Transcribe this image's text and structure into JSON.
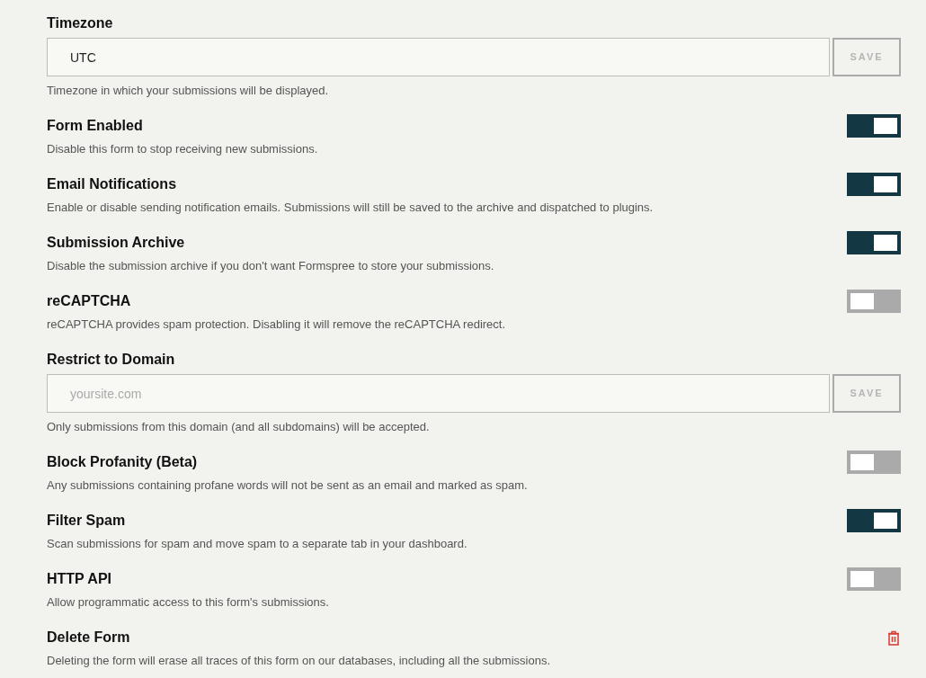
{
  "settings": [
    {
      "kind": "text",
      "title": "Timezone",
      "value": "UTC",
      "button": "SAVE",
      "description": "Timezone in which your submissions will be displayed."
    },
    {
      "kind": "toggle",
      "title": "Form Enabled",
      "on": true,
      "description": "Disable this form to stop receiving new submissions."
    },
    {
      "kind": "toggle",
      "title": "Email Notifications",
      "on": true,
      "description": "Enable or disable sending notification emails. Submissions will still be saved to the archive and dispatched to plugins."
    },
    {
      "kind": "toggle",
      "title": "Submission Archive",
      "on": true,
      "description": "Disable the submission archive if you don't want Formspree to store your submissions."
    },
    {
      "kind": "toggle",
      "title": "reCAPTCHA",
      "on": false,
      "description": "reCAPTCHA provides spam protection. Disabling it will remove the reCAPTCHA redirect."
    },
    {
      "kind": "text",
      "title": "Restrict to Domain",
      "placeholder": "yoursite.com",
      "button": "SAVE",
      "description": "Only submissions from this domain (and all subdomains) will be accepted."
    },
    {
      "kind": "toggle",
      "title": "Block Profanity (Beta)",
      "on": false,
      "description": "Any submissions containing profane words will not be sent as an email and marked as spam."
    },
    {
      "kind": "toggle",
      "title": "Filter Spam",
      "on": true,
      "description": "Scan submissions for spam and move spam to a separate tab in your dashboard."
    },
    {
      "kind": "toggle",
      "title": "HTTP API",
      "on": false,
      "description": "Allow programmatic access to this form's submissions."
    },
    {
      "kind": "delete",
      "title": "Delete Form",
      "description": "Deleting the form will erase all traces of this form on our databases, including all the submissions."
    }
  ]
}
